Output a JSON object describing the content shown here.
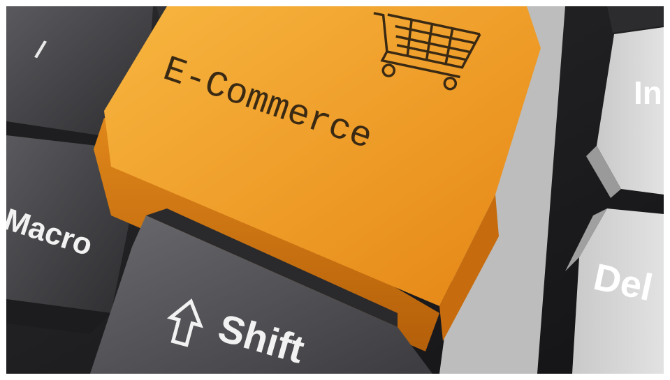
{
  "keys": {
    "ecommerce_label": "E-Commerce",
    "macro_label": "Macro",
    "shift_label": "Shift",
    "insert_label": "In",
    "delete_label": "Del",
    "top_left_label": "/"
  },
  "icons": {
    "cart": "shopping-cart-icon",
    "shift_arrow": "shift-arrow-icon"
  },
  "colors": {
    "accent_orange": "#e9951f",
    "dark_key": "#3a3a3c",
    "light_key": "#d7d7d7",
    "background": "#1b1b1d"
  }
}
